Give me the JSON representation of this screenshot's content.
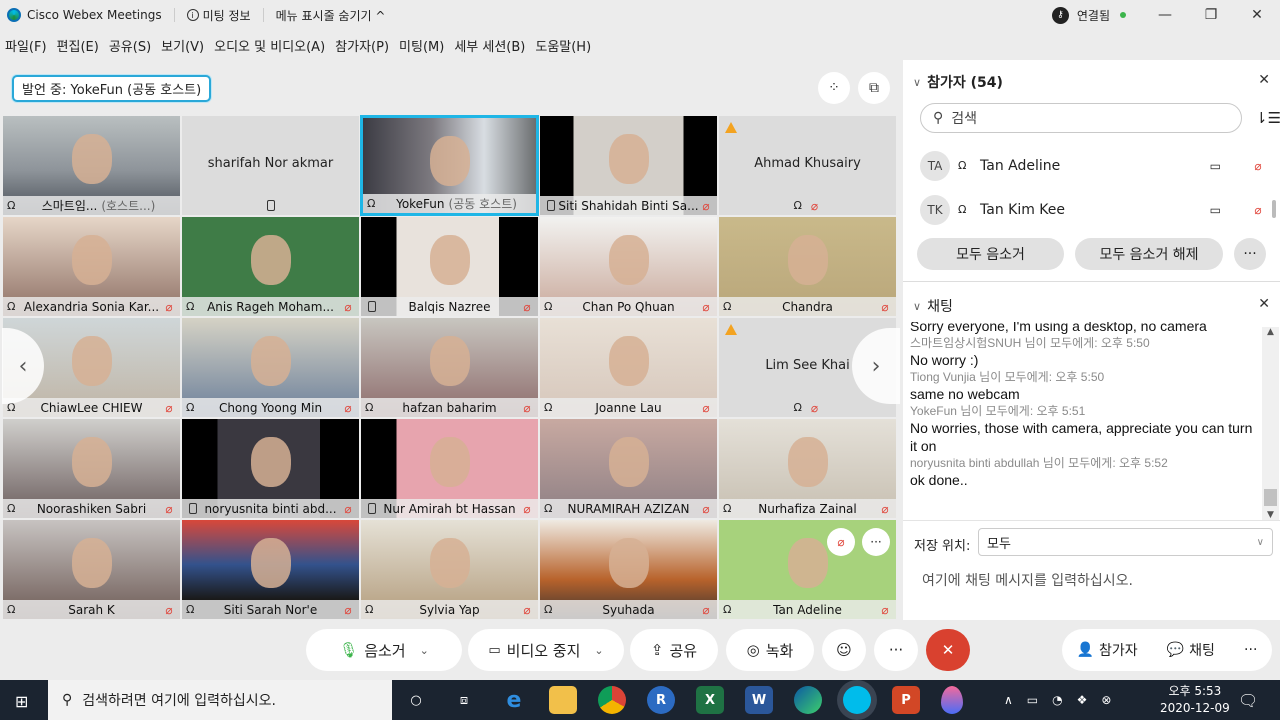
{
  "titlebar": {
    "app_name": "Cisco Webex Meetings",
    "meeting_info": "미팅 정보",
    "hide_menu": "메뉴 표시줄 숨기기 ^",
    "connection_status": "연결됨",
    "status_color": "#3cb44b"
  },
  "menu": [
    "파일(F)",
    "편집(E)",
    "공유(S)",
    "보기(V)",
    "오디오 및 비디오(A)",
    "참가자(P)",
    "미팅(M)",
    "세부 세션(B)",
    "도움말(H)"
  ],
  "speaking": "발언 중: YokeFun (공동 호스트)",
  "tiles": [
    {
      "name": "스마트임...",
      "sub": "(호스트...)",
      "audio": "headset",
      "muted": false,
      "video": true
    },
    {
      "name": "sharifah Nor akmar",
      "audio": "phone",
      "muted": false,
      "video": false
    },
    {
      "name": "YokeFun",
      "sub": "(공동 호스트)",
      "audio": "headset",
      "muted": false,
      "video": true,
      "active": true
    },
    {
      "name": "Siti Shahidah Binti Sa...",
      "audio": "phone",
      "muted": true,
      "video": true
    },
    {
      "name": "Ahmad Khusairy",
      "audio": "headset",
      "muted": true,
      "video": false,
      "warning": true
    },
    {
      "name": "Alexandria Sonia Kar...",
      "audio": "headset",
      "muted": true,
      "video": true
    },
    {
      "name": "Anis Rageh Moham...",
      "audio": "headset",
      "muted": true,
      "video": true
    },
    {
      "name": "Balqis Nazree",
      "audio": "phone",
      "muted": true,
      "video": true
    },
    {
      "name": "Chan Po Qhuan",
      "audio": "headset",
      "muted": true,
      "video": true
    },
    {
      "name": "Chandra",
      "audio": "headset",
      "muted": true,
      "video": true
    },
    {
      "name": "ChiawLee CHIEW",
      "audio": "headset",
      "muted": true,
      "video": true
    },
    {
      "name": "Chong Yoong Min",
      "audio": "headset",
      "muted": true,
      "video": true
    },
    {
      "name": "hafzan baharim",
      "audio": "headset",
      "muted": true,
      "video": true
    },
    {
      "name": "Joanne Lau",
      "audio": "headset",
      "muted": true,
      "video": true
    },
    {
      "name": "Lim See Khai",
      "audio": "headset",
      "muted": true,
      "video": false,
      "warning": true
    },
    {
      "name": "Noorashiken Sabri",
      "audio": "headset",
      "muted": true,
      "video": true
    },
    {
      "name": "noryusnita binti abd...",
      "audio": "phone",
      "muted": true,
      "video": true
    },
    {
      "name": "Nur Amirah bt Hassan",
      "audio": "phone",
      "muted": true,
      "video": true
    },
    {
      "name": "NURAMIRAH AZIZAN",
      "audio": "headset",
      "muted": true,
      "video": true
    },
    {
      "name": "Nurhafiza Zainal",
      "audio": "headset",
      "muted": true,
      "video": true
    },
    {
      "name": "Sarah K",
      "audio": "headset",
      "muted": true,
      "video": true
    },
    {
      "name": "Siti Sarah Nor'e",
      "audio": "headset",
      "muted": true,
      "video": true
    },
    {
      "name": "Sylvia Yap",
      "audio": "headset",
      "muted": true,
      "video": true
    },
    {
      "name": "Syuhada",
      "audio": "headset",
      "muted": true,
      "video": true
    },
    {
      "name": "Tan Adeline",
      "audio": "headset",
      "muted": true,
      "video": true,
      "hover": true
    }
  ],
  "toolbar": {
    "mute": "음소거",
    "stop_video": "비디오 중지",
    "share": "공유",
    "record": "녹화",
    "participants": "참가자",
    "chat": "채팅",
    "end_color": "#d9412f"
  },
  "participants_panel": {
    "title": "참가자 (54)",
    "search_placeholder": "검색",
    "list": [
      {
        "initials": "TA",
        "name": "Tan Adeline"
      },
      {
        "initials": "TK",
        "name": "Tan Kim Kee"
      }
    ],
    "mute_all": "모두 음소거",
    "unmute_all": "모두 음소거 해제"
  },
  "chat_panel": {
    "title": "채팅",
    "messages": [
      {
        "meta": "",
        "text": "Sorry everyone, I'm using a desktop, no camera"
      },
      {
        "meta": "스마트임상시험SNUH 님이 모두에게:    오후 5:50",
        "text": "No worry :)"
      },
      {
        "meta": "Tiong Vunjia 님이 모두에게:    오후 5:50",
        "text": "same no webcam"
      },
      {
        "meta": "YokeFun 님이 모두에게:    오후 5:51",
        "text": "No worries, those with camera, appreciate you can turn it on"
      },
      {
        "meta": "noryusnita binti abdullah 님이 모두에게:    오후 5:52",
        "text": "ok done.."
      }
    ],
    "send_to_label": "저장 위치:",
    "send_to_value": "모두",
    "input_placeholder": "여기에 채팅 메시지를 입력하십시오."
  },
  "taskbar": {
    "search_placeholder": "검색하려면 여기에 입력하십시오.",
    "time": "오후 5:53",
    "date": "2020-12-09"
  }
}
